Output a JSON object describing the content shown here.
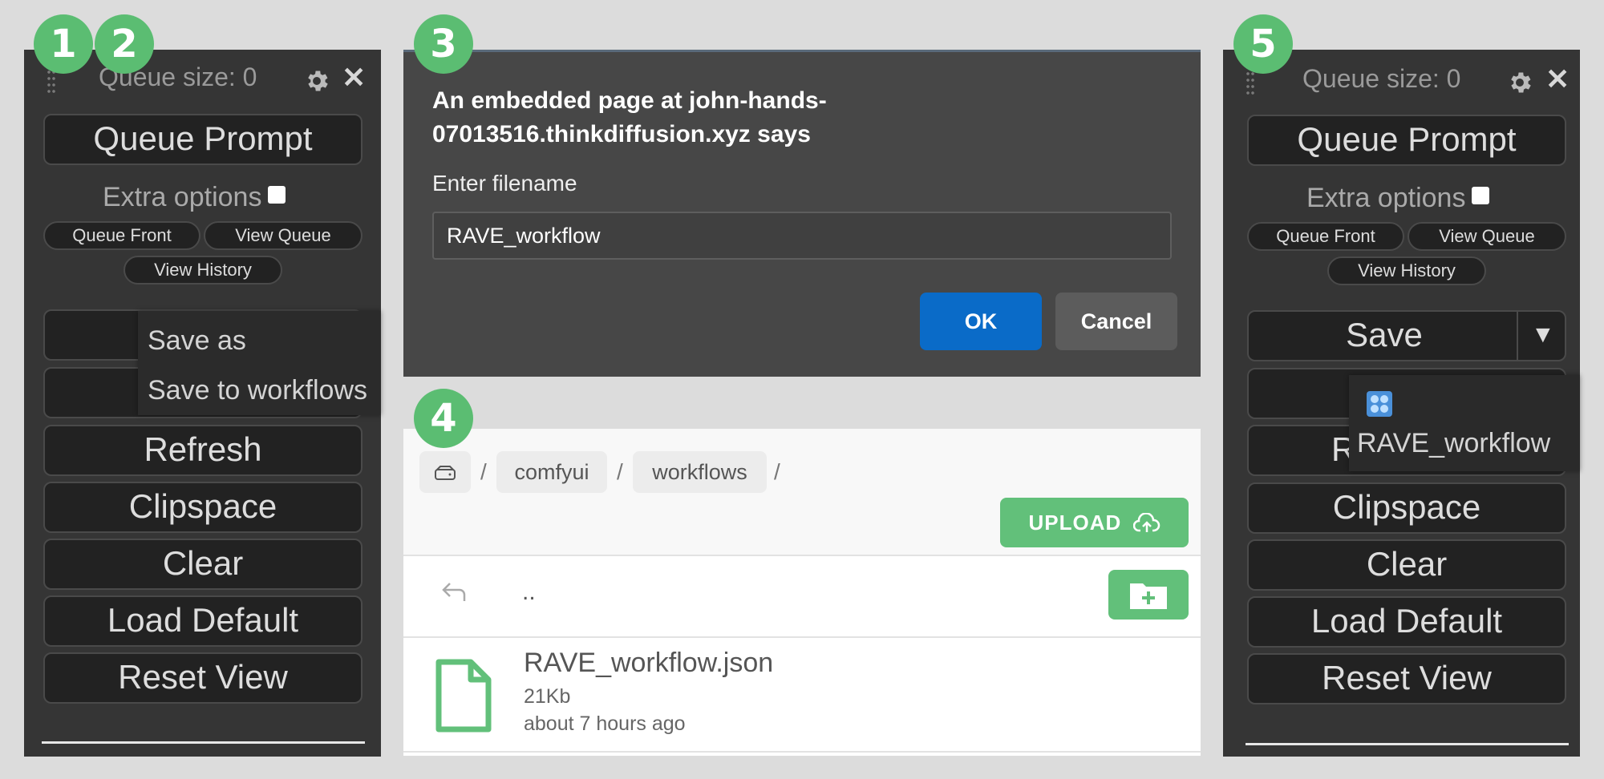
{
  "badges": [
    "1",
    "2",
    "3",
    "4",
    "5"
  ],
  "panel_left": {
    "queue_size": "Queue size: 0",
    "queue_prompt": "Queue Prompt",
    "extra_options": "Extra options",
    "queue_front": "Queue Front",
    "view_queue": "View Queue",
    "view_history": "View History",
    "refresh": "Refresh",
    "clipspace": "Clipspace",
    "clear": "Clear",
    "load_default": "Load Default",
    "reset_view": "Reset View",
    "context_menu": [
      "Save as",
      "Save to workflows"
    ]
  },
  "dialog": {
    "message": "An embedded page at john-hands-07013516.thinkdiffusion.xyz says",
    "label": "Enter filename",
    "input_value": "RAVE_workflow",
    "ok": "OK",
    "cancel": "Cancel"
  },
  "file_browser": {
    "breadcrumbs": [
      "comfyui",
      "workflows"
    ],
    "separator": "/",
    "upload": "UPLOAD",
    "parent_dir": "..",
    "file": {
      "name": "RAVE_workflow.json",
      "size": "21Kb",
      "modified": "about 7 hours ago"
    }
  },
  "panel_right": {
    "queue_size": "Queue size: 0",
    "queue_prompt": "Queue Prompt",
    "extra_options": "Extra options",
    "queue_front": "Queue Front",
    "view_queue": "View Queue",
    "view_history": "View History",
    "save": "Save",
    "dropdown_arrow": "▼",
    "refresh_partial": "R",
    "clipspace": "Clipspace",
    "clear": "Clear",
    "load_default": "Load Default",
    "reset_view": "Reset View",
    "workflow_item": "RAVE_workflow"
  },
  "colors": {
    "badge": "#5bbd72",
    "ok_button": "#0a6bc8",
    "upload_button": "#62c07a"
  }
}
